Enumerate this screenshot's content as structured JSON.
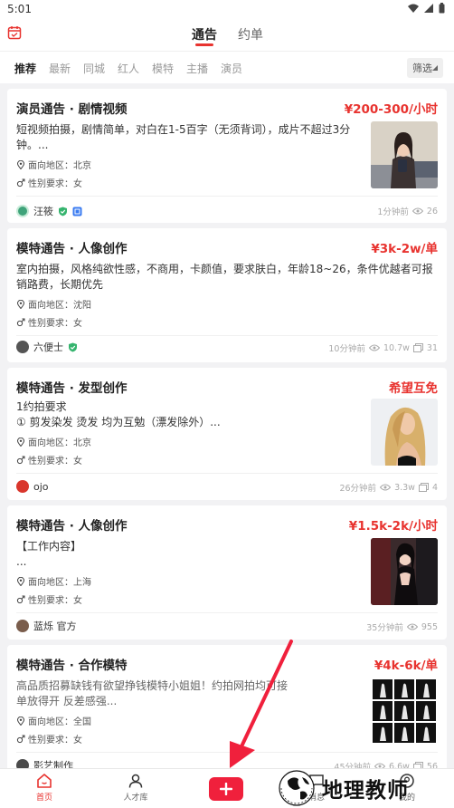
{
  "status": {
    "time": "5:01"
  },
  "tabs": [
    {
      "label": "通告",
      "active": true
    },
    {
      "label": "约单",
      "active": false
    }
  ],
  "filters": [
    "推荐",
    "最新",
    "同城",
    "红人",
    "模特",
    "主播",
    "演员"
  ],
  "filter_button": "筛选",
  "cards": [
    {
      "title": "演员通告 · 剧情视频",
      "price": "¥200-300/小时",
      "desc": "短视频拍摄，剧情简单，对白在1-5百字（无须背词），成片不超过3分钟。...",
      "region": "面向地区：北京",
      "gender": "性别要求：女",
      "author": "汪筱",
      "time": "1分钟前",
      "views": "26",
      "images": "",
      "has_thumb": true
    },
    {
      "title": "模特通告 · 人像创作",
      "price": "¥3k-2w/单",
      "desc": "室内拍摄，风格纯欲性感，不商用，卡颜值，要求肤白，年龄18~26，条件优越者可报销路费，长期优先",
      "region": "面向地区：沈阳",
      "gender": "性别要求：女",
      "author": "六便士",
      "time": "10分钟前",
      "views": "10.7w",
      "images": "31",
      "has_thumb": false
    },
    {
      "title": "模特通告 · 发型创作",
      "price": "希望互免",
      "desc": "1约拍要求\n① 剪发染发 烫发 均为互勉（漂发除外）...",
      "region": "面向地区：北京",
      "gender": "性别要求：女",
      "author": "ojo",
      "time": "26分钟前",
      "views": "3.3w",
      "images": "4",
      "has_thumb": true
    },
    {
      "title": "模特通告 · 人像创作",
      "price": "¥1.5k-2k/小时",
      "desc": "【工作内容】\n...",
      "region": "面向地区：上海",
      "gender": "性别要求：女",
      "author": "蓝烁 官方",
      "time": "35分钟前",
      "views": "955",
      "images": "",
      "has_thumb": true
    },
    {
      "title": "模特通告 · 合作模特",
      "price": "¥4k-6k/单",
      "desc": "高品质招募缺钱有欲望挣钱模特小姐姐！约拍网拍均可接单放得开 反差感强...",
      "region": "面向地区：全国",
      "gender": "性别要求：女",
      "author": "影艺制作",
      "time": "45分钟前",
      "views": "6.6w",
      "images": "56",
      "has_thumb": true
    }
  ],
  "nav": [
    {
      "label": "首页",
      "active": true
    },
    {
      "label": "人才库",
      "active": false
    },
    {
      "label": "消息",
      "active": false
    },
    {
      "label": "我的",
      "active": false
    }
  ],
  "watermark": "地理教师",
  "colors": {
    "accent": "#e8332f",
    "add_button": "#f0203c",
    "background": "#f2f2f4"
  }
}
